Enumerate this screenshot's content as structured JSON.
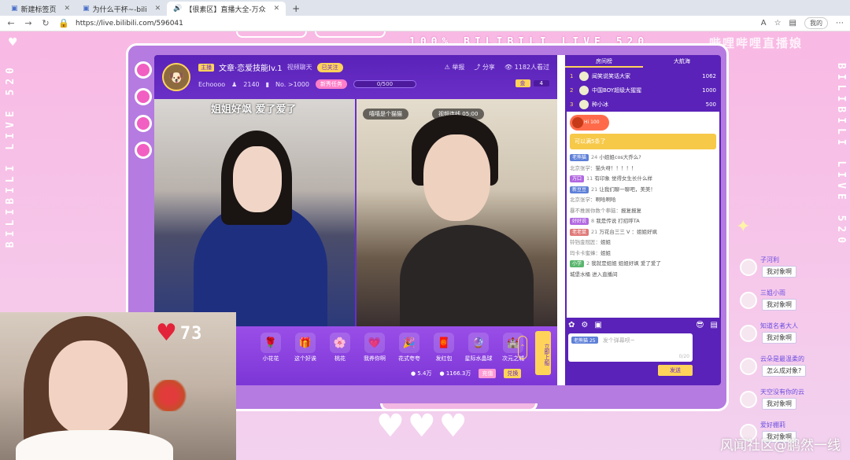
{
  "browser": {
    "tabs": [
      {
        "label": "新建标签页",
        "active": false
      },
      {
        "label": "为什么干杯~-bili",
        "active": false
      },
      {
        "label": "【很素区】直播大全-万众",
        "active": true
      }
    ],
    "new_tab": "+",
    "url": "https://live.bilibili.com/596041",
    "user": "我的"
  },
  "page": {
    "marquee": "100% BILIBILI LIVE 520",
    "side_text": "BILIBILI LIVE 520",
    "top_watermark": "哔哩哔哩直播娘"
  },
  "room": {
    "tag": "主播",
    "title": "文章·恋爱技能lv.1",
    "category": "视频聊天",
    "follow": "已关注",
    "uploader": "Echoooo",
    "fans": "2140",
    "rank": "No. >1000",
    "task": "新秀任务",
    "task_progress": "0/500",
    "report": "举报",
    "share": "分享",
    "viewers": "1182人看过",
    "gold_label": "金",
    "gold_count": "4"
  },
  "videos": {
    "left_caption": "姐姐好飒  爱了爱了",
    "right_user": "嘻嘻是个猫猫",
    "right_status": "视频连线",
    "right_time": "05:00"
  },
  "gifts": {
    "items": [
      {
        "label": "小花花",
        "icon": "🌹"
      },
      {
        "label": "这个好诶",
        "icon": "🎁"
      },
      {
        "label": "桃花",
        "icon": "🌸"
      },
      {
        "label": "我养你啊",
        "icon": "💗"
      },
      {
        "label": "花式夸夸",
        "icon": "🎉"
      },
      {
        "label": "发红包",
        "icon": "🧧"
      },
      {
        "label": "星际水晶球",
        "icon": "🔮"
      },
      {
        "label": "次元之城",
        "icon": "🏰"
      }
    ],
    "pack_label": "立即上船",
    "battery": "5.4万",
    "silver": "1166.3万",
    "recharge": "充值",
    "other": "兑换"
  },
  "heart_counter": "73",
  "rank": {
    "tabs": [
      "房间榜",
      "大航海"
    ],
    "rows": [
      {
        "n": "1",
        "name": "闻笑说笑话大家",
        "score": "1062"
      },
      {
        "n": "2",
        "name": "中国BOY超级大猩猩",
        "score": "1000"
      },
      {
        "n": "3",
        "name": "种小冰",
        "score": "500"
      }
    ]
  },
  "chat": {
    "hi_card": "Hi 100",
    "system": "可以满5条了",
    "messages": [
      {
        "badge": "老熊猫",
        "lv": "24",
        "user": "",
        "text": "小姐姐cos大乔么?",
        "c": ""
      },
      {
        "badge": "",
        "lv": "",
        "user": "北京张学：",
        "text": "猫头呀！！！！！",
        "c": ""
      },
      {
        "badge": "万口",
        "lv": "11",
        "user": "",
        "text": "有印象  觉得女生长什么样",
        "c": "p"
      },
      {
        "badge": "新豆豆",
        "lv": "21",
        "user": "",
        "text": "让我们聊一聊吧，美美！",
        "c": ""
      },
      {
        "badge": "",
        "lv": "",
        "user": "北京张学：",
        "text": "啊哈啊哈",
        "c": ""
      },
      {
        "badge": "",
        "lv": "",
        "user": "暴不推展你数个拳脑：",
        "text": "报复报复",
        "c": ""
      },
      {
        "badge": "好好说",
        "lv": "8",
        "user": "",
        "text": "我是传说  打招呼TA",
        "c": "p"
      },
      {
        "badge": "老老鼠",
        "lv": "21",
        "user": "",
        "text": "万花台三三 V  ：姐姐好飒",
        "c": "r"
      },
      {
        "badge": "",
        "lv": "",
        "user": "铃铛金冠匠：",
        "text": "姐姐",
        "c": ""
      },
      {
        "badge": "",
        "lv": "",
        "user": "玛卡卡蜜蜂：",
        "text": "姐姐",
        "c": ""
      },
      {
        "badge": "小学",
        "lv": "2",
        "user": "",
        "text": "我就是姐姐  姐姐好飒 爱了爱了",
        "c": "g"
      },
      {
        "badge": "",
        "lv": "",
        "user": "",
        "text": "城堡水桶  进入直播间",
        "c": ""
      }
    ],
    "input_badge": "老熊猫",
    "input_lv": "25",
    "input_placeholder": "发个弹幕呗~",
    "input_count": "0/20",
    "send": "发送"
  },
  "bubbles": [
    {
      "name": "子河利",
      "text": "我对象啊"
    },
    {
      "name": "三姐小雨",
      "text": "我对象啊"
    },
    {
      "name": "知道名者大人",
      "text": "我对象啊"
    },
    {
      "name": "云朵是最温柔的",
      "text": "怎么成对象?"
    },
    {
      "name": "天空没有你的云",
      "text": "我对象啊"
    },
    {
      "name": "爱好棚莉",
      "text": "我对象啊"
    }
  ],
  "watermark": "风闻社区@鹏然一线",
  "colors": {
    "accent": "#6a2fc7",
    "pink": "#f25fc2",
    "gold": "#ffd35a"
  }
}
